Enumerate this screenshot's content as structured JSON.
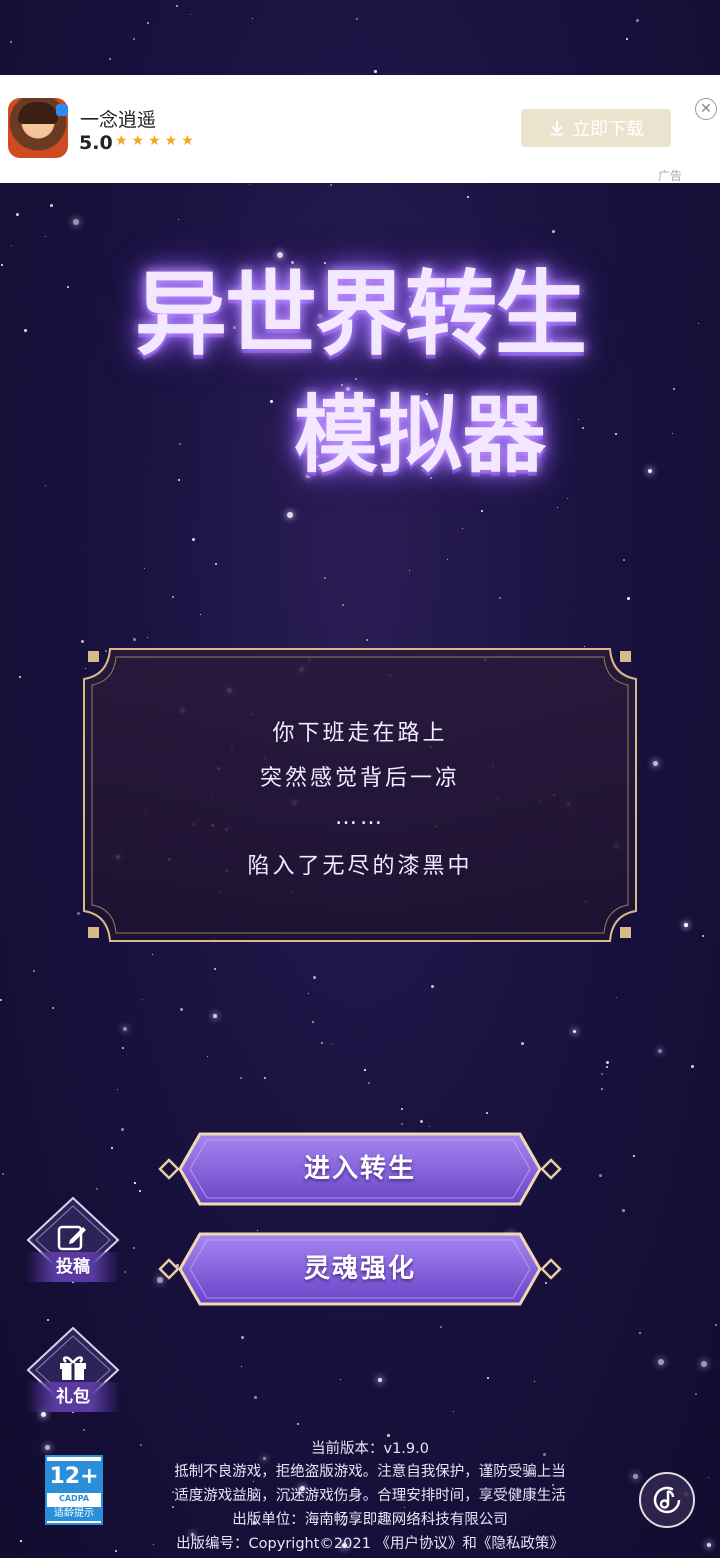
{
  "ad": {
    "app_name": "一念逍遥",
    "rating": "5.0",
    "stars": "★★★★★",
    "download_label": "立即下载",
    "close_glyph": "✕",
    "ad_label": "广告"
  },
  "logo": {
    "line1": "异世界转生",
    "line2": "模拟器"
  },
  "story": {
    "lines": [
      "你下班走在路上",
      "突然感觉背后一凉",
      "……",
      "陷入了无尽的漆黑中"
    ]
  },
  "buttons": {
    "enter": "进入转生",
    "soul": "灵魂强化"
  },
  "side": {
    "submit": "投稿",
    "gift": "礼包"
  },
  "footer": {
    "version": "当前版本：v1.9.0",
    "notice1": "抵制不良游戏，拒绝盗版游戏。注意自我保护，谨防受骗上当",
    "notice2": "适度游戏益脑，沉迷游戏伤身。合理安排时间，享受健康生活",
    "publisher": "出版单位：海南畅享即趣网络科技有限公司",
    "copyright": "出版编号：Copyright©2021 《用户协议》和《隐私政策》"
  },
  "age_badge": {
    "age": "12+",
    "org": "CADPA",
    "tip": "适龄提示"
  },
  "icons": {
    "download": "download-icon",
    "edit": "edit-icon",
    "gift": "gift-icon",
    "music": "music-icon"
  },
  "colors": {
    "background": "#1a1240",
    "accent_purple": "#8b5cf6",
    "gold_frame": "#d9b98a",
    "download_button": "#ece3cf",
    "age_blue": "#2a8fd8"
  }
}
